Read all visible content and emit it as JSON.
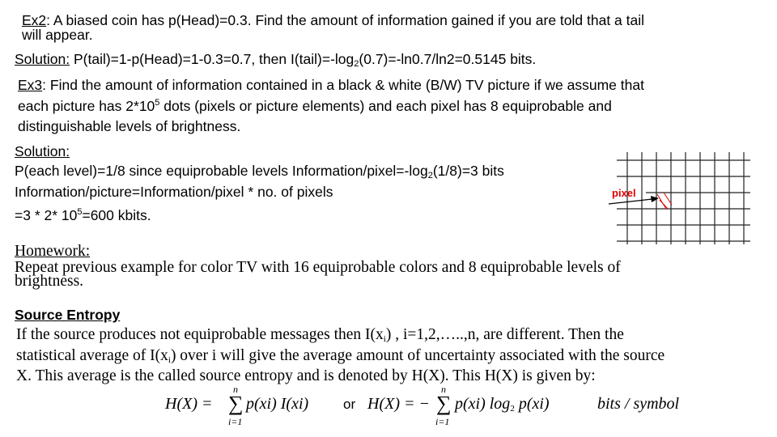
{
  "ex2": {
    "label": "Ex2",
    "line1": ": A biased coin has p(Head)=0.3. Find the amount of information gained  if you are told that a tail",
    "line2": "will appear."
  },
  "sol1": {
    "label": "Solution:",
    "text_a": " P(tail)=1-p(Head)=1-0.3=0.7, then  I(tail)=-log",
    "sub": "2",
    "text_b": "(0.7)=-ln0.7/ln2=0.5145 bits."
  },
  "ex3": {
    "label": "Ex3",
    "line1": ": Find the amount of information contained in a black & white (B/W) TV  picture if we assume that",
    "line2_a": "each picture has 2*10",
    "line2_sup": "5",
    "line2_b": " dots (pixels or picture  elements) and each pixel has 8 equiprobable and",
    "line3": "distinguishable levels of  brightness."
  },
  "sol2": {
    "label": "Solution:",
    "line1_a": "P(each level)=1/8 since equiprobable levels  Information/pixel=-log",
    "line1_sub": "2",
    "line1_b": "(1/8)=3 bits",
    "line2": "Information/picture=Information/pixel * no. of pixels",
    "line3_a": "=3 * 2* 10",
    "line3_sup": "5",
    "line3_b": "=600 kbits."
  },
  "diagram": {
    "pixel_label": "pixel",
    "label_color": "#e00000"
  },
  "homework": {
    "label": "Homework:",
    "line1": "Repeat previous example for color TV with 16 equiprobable colors and 8  equiprobable levels of",
    "line2": "brightness."
  },
  "entropy": {
    "title": "Source Entropy",
    "line1_a": "If the source produces not equiprobable messages then I(x",
    "line1_sub": "i",
    "line1_b": ") , i=1,2,…..,n, are  different. Then the",
    "line2_a": "statistical average of I(x",
    "line2_sub": "i",
    "line2_b": ") over i will give the average  amount of uncertainty associated with the source",
    "line3": "X. This average is the  called source entropy and is denoted by H(X). This H(X) is given by:"
  },
  "formula": {
    "lhs1": "H(X) = ",
    "sum": "∑",
    "upper": "n",
    "lower": "i=1",
    "body1": "p(xi) I(xi)",
    "or": "or",
    "lhs2": "H(X) = −",
    "body2a": "p(xi) log",
    "body2sub": "2",
    "body2b": " p(xi)",
    "units": "bits / symbol"
  }
}
